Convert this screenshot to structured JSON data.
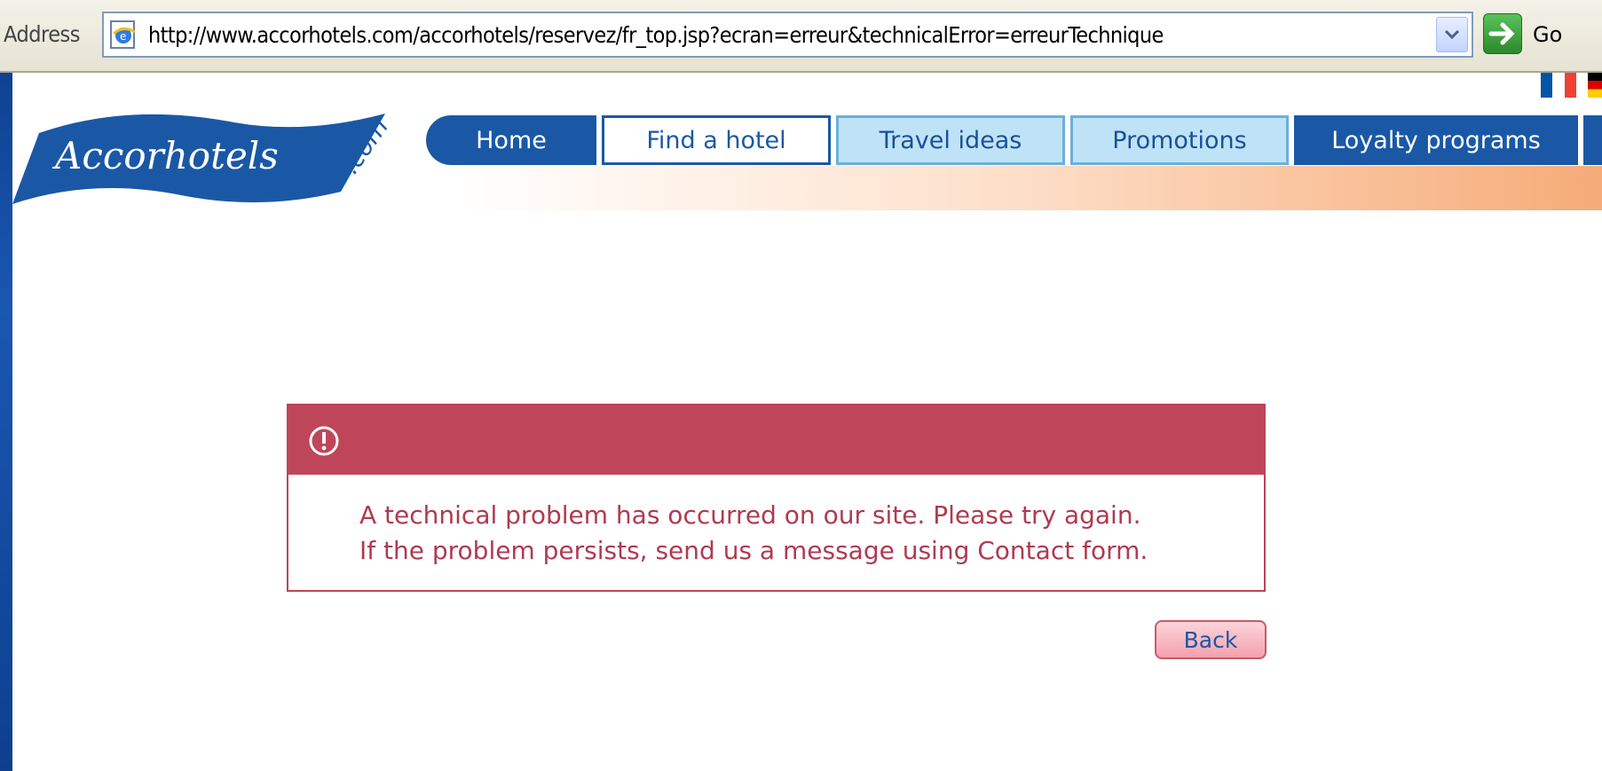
{
  "browser": {
    "address_label": "Address",
    "url": "http://www.accorhotels.com/accorhotels/reservez/fr_top.jsp?ecran=erreur&technicalError=erreurTechnique",
    "go_label": "Go"
  },
  "site": {
    "logo_main": "Accorhotels",
    "logo_suffix": ".com",
    "nav": {
      "home": "Home",
      "find": "Find a hotel",
      "travel": "Travel ideas",
      "promotions": "Promotions",
      "loyalty": "Loyalty programs"
    }
  },
  "error": {
    "line1": "A technical problem has occurred on our site. Please try again.",
    "line2": "If the problem persists, send us a message using Contact form.",
    "back_label": "Back"
  },
  "colors": {
    "brand_blue": "#1a58a6",
    "error_red": "#bf4659"
  },
  "icons": [
    "ie-page-icon",
    "dropdown-arrow-icon",
    "go-arrow-icon",
    "warning-icon",
    "flag-fr-icon",
    "flag-de-icon"
  ]
}
